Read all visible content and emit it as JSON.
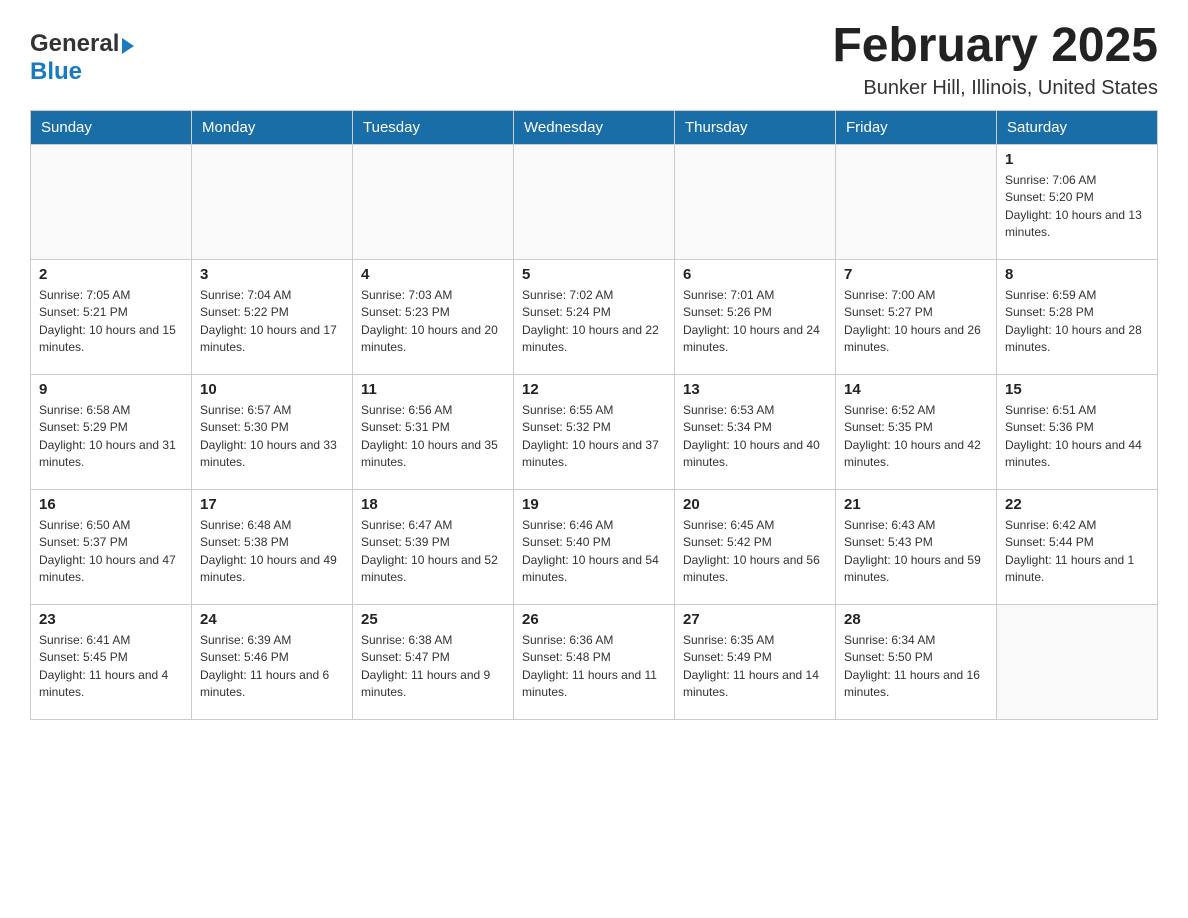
{
  "header": {
    "logo": {
      "general": "General",
      "blue": "Blue",
      "arrow": "▶"
    },
    "title": "February 2025",
    "location": "Bunker Hill, Illinois, United States"
  },
  "calendar": {
    "days_of_week": [
      "Sunday",
      "Monday",
      "Tuesday",
      "Wednesday",
      "Thursday",
      "Friday",
      "Saturday"
    ],
    "weeks": [
      [
        {
          "day": "",
          "info": ""
        },
        {
          "day": "",
          "info": ""
        },
        {
          "day": "",
          "info": ""
        },
        {
          "day": "",
          "info": ""
        },
        {
          "day": "",
          "info": ""
        },
        {
          "day": "",
          "info": ""
        },
        {
          "day": "1",
          "info": "Sunrise: 7:06 AM\nSunset: 5:20 PM\nDaylight: 10 hours and 13 minutes."
        }
      ],
      [
        {
          "day": "2",
          "info": "Sunrise: 7:05 AM\nSunset: 5:21 PM\nDaylight: 10 hours and 15 minutes."
        },
        {
          "day": "3",
          "info": "Sunrise: 7:04 AM\nSunset: 5:22 PM\nDaylight: 10 hours and 17 minutes."
        },
        {
          "day": "4",
          "info": "Sunrise: 7:03 AM\nSunset: 5:23 PM\nDaylight: 10 hours and 20 minutes."
        },
        {
          "day": "5",
          "info": "Sunrise: 7:02 AM\nSunset: 5:24 PM\nDaylight: 10 hours and 22 minutes."
        },
        {
          "day": "6",
          "info": "Sunrise: 7:01 AM\nSunset: 5:26 PM\nDaylight: 10 hours and 24 minutes."
        },
        {
          "day": "7",
          "info": "Sunrise: 7:00 AM\nSunset: 5:27 PM\nDaylight: 10 hours and 26 minutes."
        },
        {
          "day": "8",
          "info": "Sunrise: 6:59 AM\nSunset: 5:28 PM\nDaylight: 10 hours and 28 minutes."
        }
      ],
      [
        {
          "day": "9",
          "info": "Sunrise: 6:58 AM\nSunset: 5:29 PM\nDaylight: 10 hours and 31 minutes."
        },
        {
          "day": "10",
          "info": "Sunrise: 6:57 AM\nSunset: 5:30 PM\nDaylight: 10 hours and 33 minutes."
        },
        {
          "day": "11",
          "info": "Sunrise: 6:56 AM\nSunset: 5:31 PM\nDaylight: 10 hours and 35 minutes."
        },
        {
          "day": "12",
          "info": "Sunrise: 6:55 AM\nSunset: 5:32 PM\nDaylight: 10 hours and 37 minutes."
        },
        {
          "day": "13",
          "info": "Sunrise: 6:53 AM\nSunset: 5:34 PM\nDaylight: 10 hours and 40 minutes."
        },
        {
          "day": "14",
          "info": "Sunrise: 6:52 AM\nSunset: 5:35 PM\nDaylight: 10 hours and 42 minutes."
        },
        {
          "day": "15",
          "info": "Sunrise: 6:51 AM\nSunset: 5:36 PM\nDaylight: 10 hours and 44 minutes."
        }
      ],
      [
        {
          "day": "16",
          "info": "Sunrise: 6:50 AM\nSunset: 5:37 PM\nDaylight: 10 hours and 47 minutes."
        },
        {
          "day": "17",
          "info": "Sunrise: 6:48 AM\nSunset: 5:38 PM\nDaylight: 10 hours and 49 minutes."
        },
        {
          "day": "18",
          "info": "Sunrise: 6:47 AM\nSunset: 5:39 PM\nDaylight: 10 hours and 52 minutes."
        },
        {
          "day": "19",
          "info": "Sunrise: 6:46 AM\nSunset: 5:40 PM\nDaylight: 10 hours and 54 minutes."
        },
        {
          "day": "20",
          "info": "Sunrise: 6:45 AM\nSunset: 5:42 PM\nDaylight: 10 hours and 56 minutes."
        },
        {
          "day": "21",
          "info": "Sunrise: 6:43 AM\nSunset: 5:43 PM\nDaylight: 10 hours and 59 minutes."
        },
        {
          "day": "22",
          "info": "Sunrise: 6:42 AM\nSunset: 5:44 PM\nDaylight: 11 hours and 1 minute."
        }
      ],
      [
        {
          "day": "23",
          "info": "Sunrise: 6:41 AM\nSunset: 5:45 PM\nDaylight: 11 hours and 4 minutes."
        },
        {
          "day": "24",
          "info": "Sunrise: 6:39 AM\nSunset: 5:46 PM\nDaylight: 11 hours and 6 minutes."
        },
        {
          "day": "25",
          "info": "Sunrise: 6:38 AM\nSunset: 5:47 PM\nDaylight: 11 hours and 9 minutes."
        },
        {
          "day": "26",
          "info": "Sunrise: 6:36 AM\nSunset: 5:48 PM\nDaylight: 11 hours and 11 minutes."
        },
        {
          "day": "27",
          "info": "Sunrise: 6:35 AM\nSunset: 5:49 PM\nDaylight: 11 hours and 14 minutes."
        },
        {
          "day": "28",
          "info": "Sunrise: 6:34 AM\nSunset: 5:50 PM\nDaylight: 11 hours and 16 minutes."
        },
        {
          "day": "",
          "info": ""
        }
      ]
    ]
  }
}
